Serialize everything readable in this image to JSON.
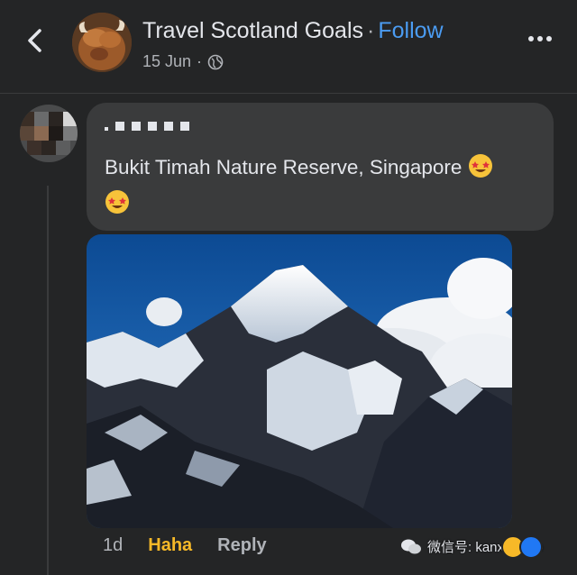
{
  "header": {
    "page_name": "Travel Scotland Goals",
    "separator": "·",
    "follow_label": "Follow",
    "date": "15 Jun",
    "meta_dot": "·"
  },
  "comment": {
    "text": "Bukit Timah Nature Reserve, Singapore",
    "emoji_count": 2
  },
  "actions": {
    "time": "1d",
    "reaction": "Haha",
    "reply": "Reply"
  },
  "watermark": {
    "text": "微信号: kanxinjiapo"
  },
  "colors": {
    "background": "#242526",
    "bubble": "#3a3b3c",
    "link": "#4b9cf2",
    "haha": "#f7b928"
  }
}
